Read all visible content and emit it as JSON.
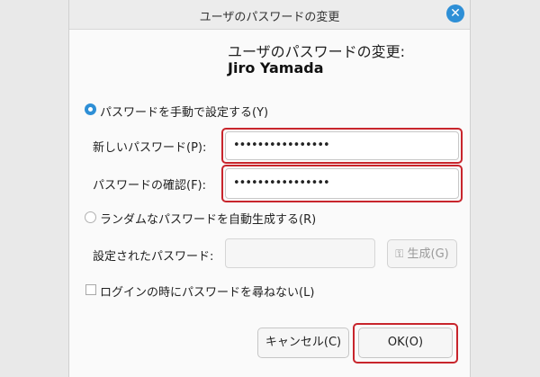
{
  "window": {
    "title": "ユーザのパスワードの変更",
    "close_glyph": "✕"
  },
  "header": {
    "line1": "ユーザのパスワードの変更:",
    "user_name": "Jiro Yamada"
  },
  "manual": {
    "radio_label": "パスワードを手動で設定する(Y)",
    "new_password_label": "新しいパスワード(P):",
    "new_password_value": "••••••••••••••••",
    "confirm_label": "パスワードの確認(F):",
    "confirm_value": "••••••••••••••••"
  },
  "random": {
    "radio_label": "ランダムなパスワードを自動生成する(R)",
    "set_password_label": "設定されたパスワード:",
    "set_password_value": "",
    "generate_label": "生成(G)"
  },
  "options": {
    "prompt_label": "ログインの時にパスワードを尋ねない(L)"
  },
  "buttons": {
    "cancel": "キャンセル(C)",
    "ok": "OK(O)"
  },
  "colors": {
    "accent": "#2e8fd6",
    "highlight": "#c8252c"
  }
}
